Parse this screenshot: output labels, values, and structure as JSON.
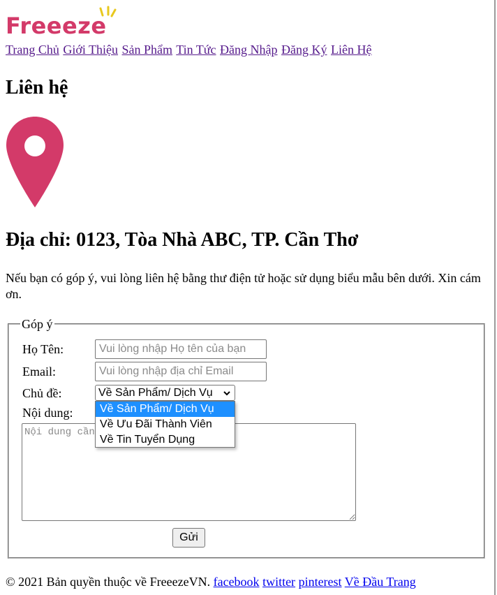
{
  "brand": {
    "logo_text": "Freeeze",
    "color": "#d33a69"
  },
  "nav": {
    "items": [
      "Trang Chủ",
      "Giới Thiệu",
      "Sản Phẩm",
      "Tin Tức",
      "Đăng Nhập",
      "Đăng Ký",
      "Liên Hệ"
    ],
    "link_color": "#551a8b"
  },
  "page": {
    "title": "Liên hệ",
    "pin_icon": "map-pin-icon",
    "address": "Địa chỉ: 0123, Tòa Nhà ABC, TP. Cần Thơ",
    "intro": "Nếu bạn có góp ý, vui lòng liên hệ bằng thư điện tử hoặc sử dụng biểu mẫu bên dưới. Xin cám ơn."
  },
  "form": {
    "legend": "Góp ý",
    "name_label": "Họ Tên:",
    "name_placeholder": "Vui lòng nhập Họ tên của bạn",
    "email_label": "Email:",
    "email_placeholder": "Vui lòng nhập địa chỉ Email",
    "subject_label": "Chủ đề:",
    "subject_selected": "Về Sản Phẩm/ Dịch Vụ",
    "subject_options": [
      "Về Sản Phẩm/ Dịch Vụ",
      "Về Ưu Đãi Thành Viên",
      "Về Tin Tuyển Dụng"
    ],
    "content_label": "Nội dung:",
    "content_placeholder": "Nội dung cần góp ý",
    "submit_label": "Gửi"
  },
  "footer": {
    "copyright": "© 2021 Bản quyền thuộc về FreeezeVN.",
    "links": [
      "facebook",
      "twitter",
      "pinterest",
      "Về Đầu Trang"
    ]
  }
}
